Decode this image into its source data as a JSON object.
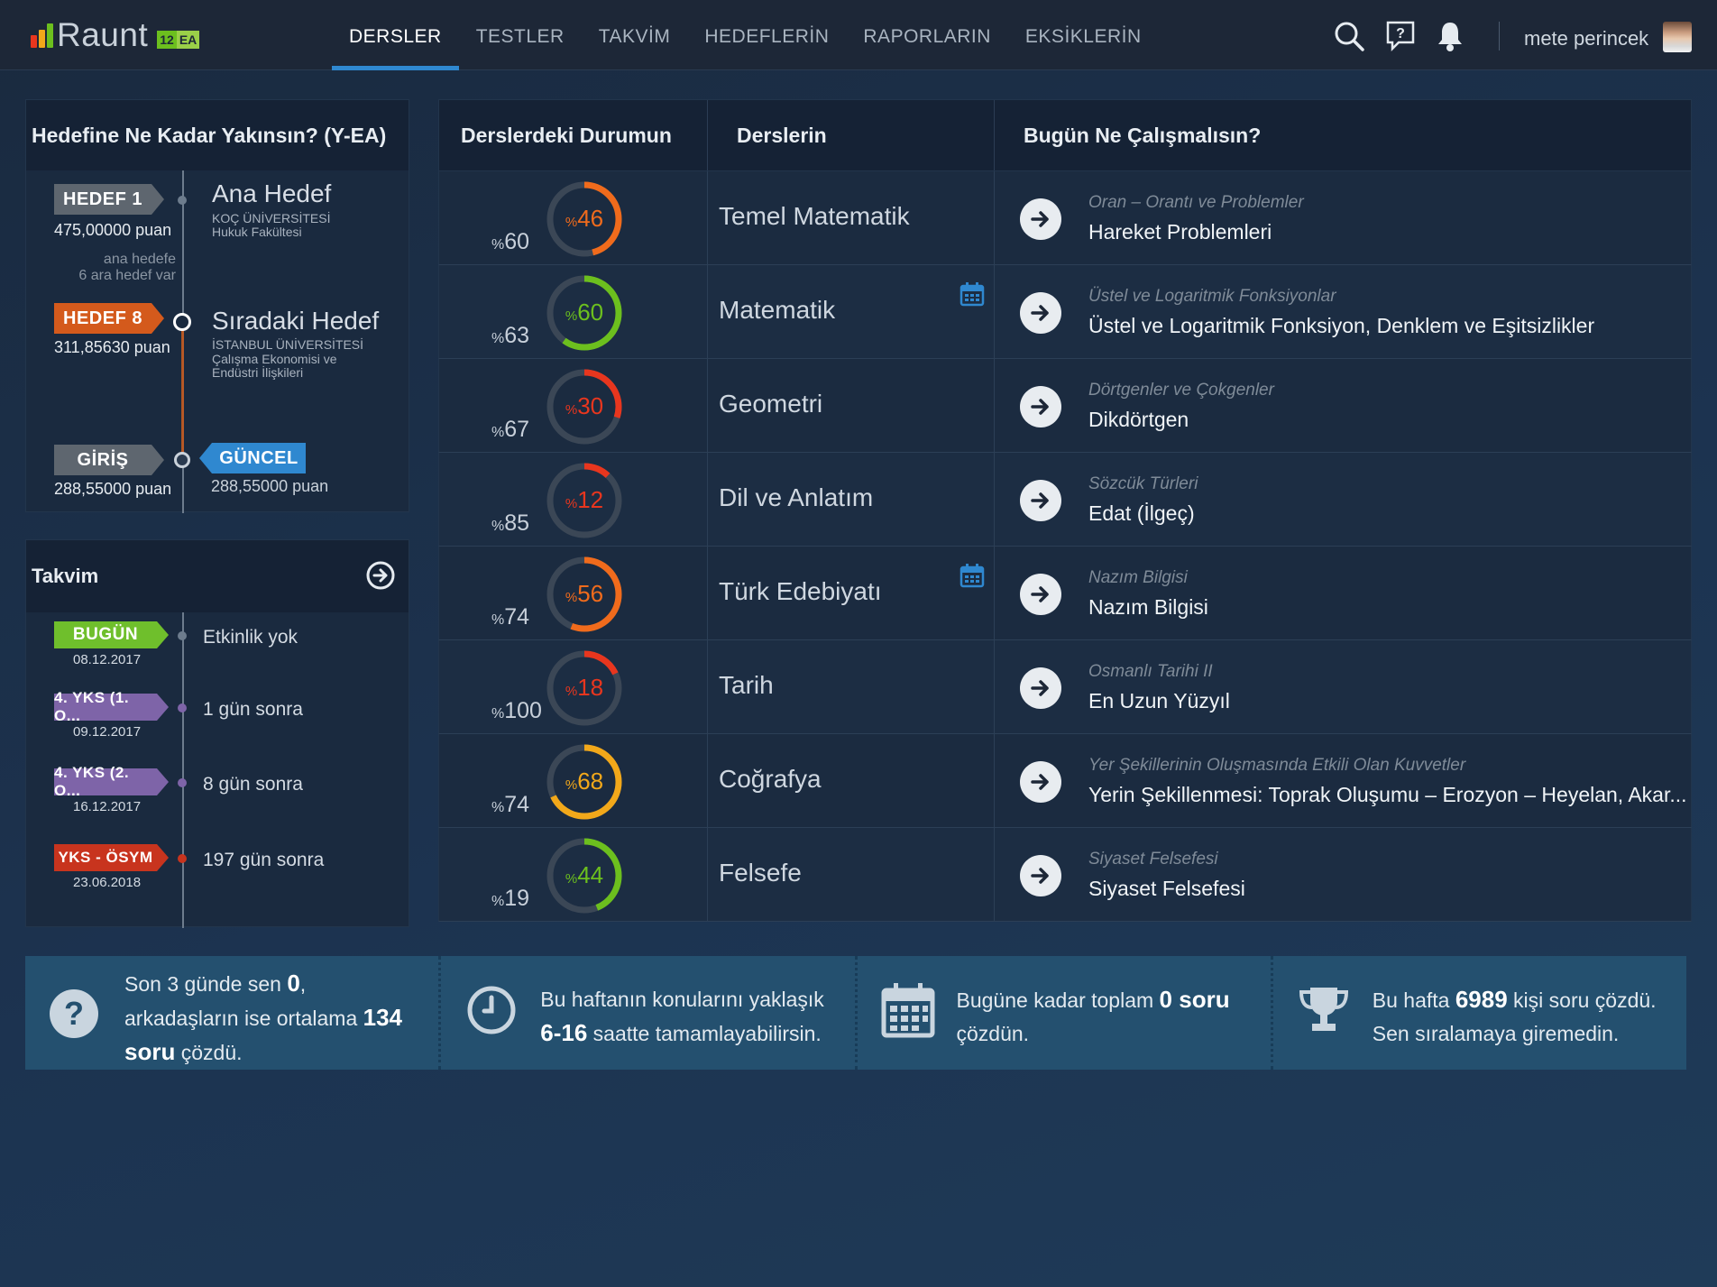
{
  "app": {
    "logo_text": "Raunt",
    "badge_num": "12",
    "badge_ea": "EA"
  },
  "nav": {
    "items": [
      {
        "label": "DERSLER"
      },
      {
        "label": "TESTLER"
      },
      {
        "label": "TAKVİM"
      },
      {
        "label": "HEDEFLERİN"
      },
      {
        "label": "RAPORLARIN"
      },
      {
        "label": "EKSİKLERİN"
      }
    ],
    "active": "DERSLER"
  },
  "user": {
    "name": "mete perincek"
  },
  "goal_panel": {
    "title": "Hedefine Ne Kadar Yakınsın? (Y-EA)",
    "main": {
      "tag": "HEDEF 1",
      "points": "475,00000 puan",
      "title": "Ana Hedef",
      "school": "KOÇ ÜNİVERSİTESİ",
      "dept": "Hukuk Fakültesi"
    },
    "remaining_line1": "ana hedefe",
    "remaining_line2": "6 ara hedef var",
    "next": {
      "tag": "HEDEF 8",
      "points": "311,85630 puan",
      "title": "Sıradaki Hedef",
      "school": "İSTANBUL ÜNİVERSİTESİ",
      "dept_line1": "Çalışma Ekonomisi ve",
      "dept_line2": "Endüstri İlişkileri"
    },
    "entry": {
      "tag": "GİRİŞ",
      "points": "288,55000 puan"
    },
    "current": {
      "tag": "GÜNCEL",
      "points": "288,55000 puan"
    },
    "progress_fraction": 0.04
  },
  "calendar_panel": {
    "title": "Takvim",
    "events": [
      {
        "tag": "BUGÜN",
        "date": "08.12.2017",
        "text": "Etkinlik yok",
        "color": "#6fbf2c"
      },
      {
        "tag": "4. YKS (1. O...",
        "date": "09.12.2017",
        "text": "1 gün sonra",
        "color": "#7e64a8"
      },
      {
        "tag": "4. YKS (2. O...",
        "date": "16.12.2017",
        "text": "8 gün sonra",
        "color": "#7e64a8"
      },
      {
        "tag": "YKS - ÖSYM",
        "date": "23.06.2018",
        "text": "197 gün sonra",
        "color": "#c8341e"
      }
    ]
  },
  "table": {
    "headers": {
      "status": "Derslerdeki Durumun",
      "subjects": "Derslerin",
      "today": "Bugün Ne Çalışmalısın?"
    },
    "rows": [
      {
        "left_pct": "60",
        "gauge_pct": "46",
        "gauge_value": 0.46,
        "gauge_color": "#f06b1c",
        "subject": "Temel Matematik",
        "has_calendar": false,
        "topic_sub": "Oran – Orantı ve Problemler",
        "topic": "Hareket Problemleri"
      },
      {
        "left_pct": "63",
        "gauge_pct": "60",
        "gauge_value": 0.6,
        "gauge_color": "#6cbf1e",
        "subject": "Matematik",
        "has_calendar": true,
        "topic_sub": "Üstel ve Logaritmik Fonksiyonlar",
        "topic": "Üstel ve Logaritmik Fonksiyon, Denklem ve Eşitsizlikler"
      },
      {
        "left_pct": "67",
        "gauge_pct": "30",
        "gauge_value": 0.3,
        "gauge_color": "#e8361e",
        "subject": "Geometri",
        "has_calendar": false,
        "topic_sub": "Dörtgenler ve Çokgenler",
        "topic": "Dikdörtgen"
      },
      {
        "left_pct": "85",
        "gauge_pct": "12",
        "gauge_value": 0.12,
        "gauge_color": "#e8361e",
        "subject": "Dil ve Anlatım",
        "has_calendar": false,
        "topic_sub": "Sözcük Türleri",
        "topic": "Edat (İlgeç)"
      },
      {
        "left_pct": "74",
        "gauge_pct": "56",
        "gauge_value": 0.56,
        "gauge_color": "#f06b1c",
        "subject": "Türk Edebiyatı",
        "has_calendar": true,
        "topic_sub": "Nazım Bilgisi",
        "topic": "Nazım Bilgisi"
      },
      {
        "left_pct": "100",
        "gauge_pct": "18",
        "gauge_value": 0.18,
        "gauge_color": "#e8361e",
        "subject": "Tarih",
        "has_calendar": false,
        "topic_sub": "Osmanlı Tarihi II",
        "topic": "En Uzun Yüzyıl"
      },
      {
        "left_pct": "74",
        "gauge_pct": "68",
        "gauge_value": 0.68,
        "gauge_color": "#f2a81a",
        "subject": "Coğrafya",
        "has_calendar": false,
        "topic_sub": "Yer Şekillerinin Oluşmasında Etkili Olan Kuvvetler",
        "topic": "Yerin Şekillenmesi: Toprak Oluşumu – Erozyon – Heyelan, Akar..."
      },
      {
        "left_pct": "19",
        "gauge_pct": "44",
        "gauge_value": 0.44,
        "gauge_color": "#6cbf1e",
        "subject": "Felsefe",
        "has_calendar": false,
        "topic_sub": "Siyaset Felsefesi",
        "topic": "Siyaset Felsefesi"
      }
    ]
  },
  "stats": [
    {
      "icon": "question-icon",
      "t1": "Son 3 günde sen ",
      "b1": "0",
      "t2": ",",
      "t3": "arkadaşların ise ortalama ",
      "b2": "134",
      "b3": "soru",
      "t4": " çözdü."
    },
    {
      "icon": "clock-icon",
      "t1": "Bu haftanın konularını yaklaşık",
      "b1": "6-16",
      "t2": " saatte tamamlayabilirsin."
    },
    {
      "icon": "calendar-icon",
      "t1": "Bugüne kadar toplam ",
      "b1": "0 soru",
      "t2": "çözdün."
    },
    {
      "icon": "trophy-icon",
      "t1": "Bu hafta ",
      "b1": "6989",
      "t2": " kişi soru çözdü.",
      "t3": "Sen sıralamaya giremedin."
    }
  ]
}
